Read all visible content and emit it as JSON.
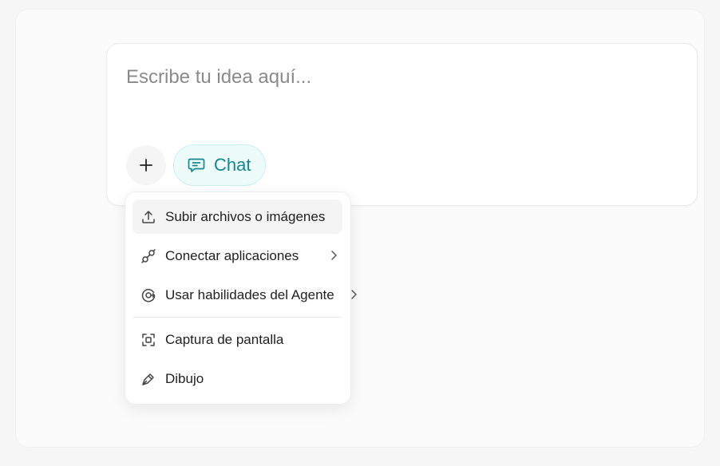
{
  "composer": {
    "placeholder": "Escribe tu idea aquí...",
    "add_icon": "plus-icon",
    "mode_chip": {
      "label": "Chat",
      "icon": "chat-bubble-icon",
      "accent_color": "#12898f",
      "background": "#eefbfb"
    }
  },
  "menu": {
    "items": [
      {
        "label": "Subir archivos o imágenes",
        "icon": "upload-icon",
        "has_submenu": false,
        "highlighted": true
      },
      {
        "label": "Conectar aplicaciones",
        "icon": "plug-icon",
        "has_submenu": true,
        "highlighted": false
      },
      {
        "label": "Usar habilidades del Agente",
        "icon": "agent-skills-icon",
        "has_submenu": true,
        "highlighted": false
      },
      {
        "label": "Captura de pantalla",
        "icon": "screenshot-icon",
        "has_submenu": false,
        "highlighted": false
      },
      {
        "label": "Dibujo",
        "icon": "pen-icon",
        "has_submenu": false,
        "highlighted": false
      }
    ]
  }
}
